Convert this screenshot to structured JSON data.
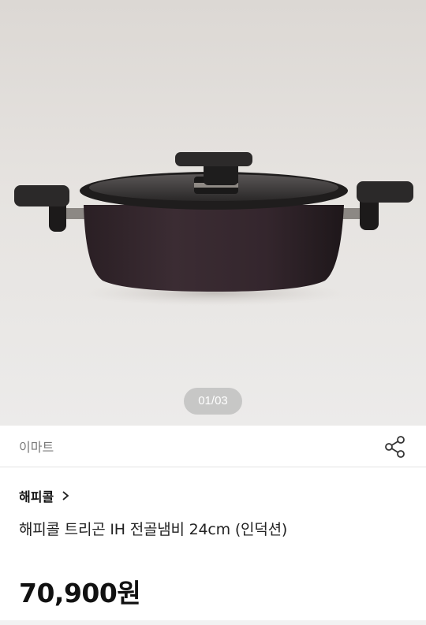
{
  "gallery": {
    "page_indicator": "01/03",
    "image_alt": "pot-image"
  },
  "seller": {
    "name": "이마트",
    "share_icon": "share-icon"
  },
  "brand": {
    "name": "해피콜",
    "chevron_icon": "chevron-right-icon"
  },
  "product": {
    "title": "해피콜 트리곤 IH 전골냄비 24cm (인덕션)",
    "price": "70,900원"
  }
}
